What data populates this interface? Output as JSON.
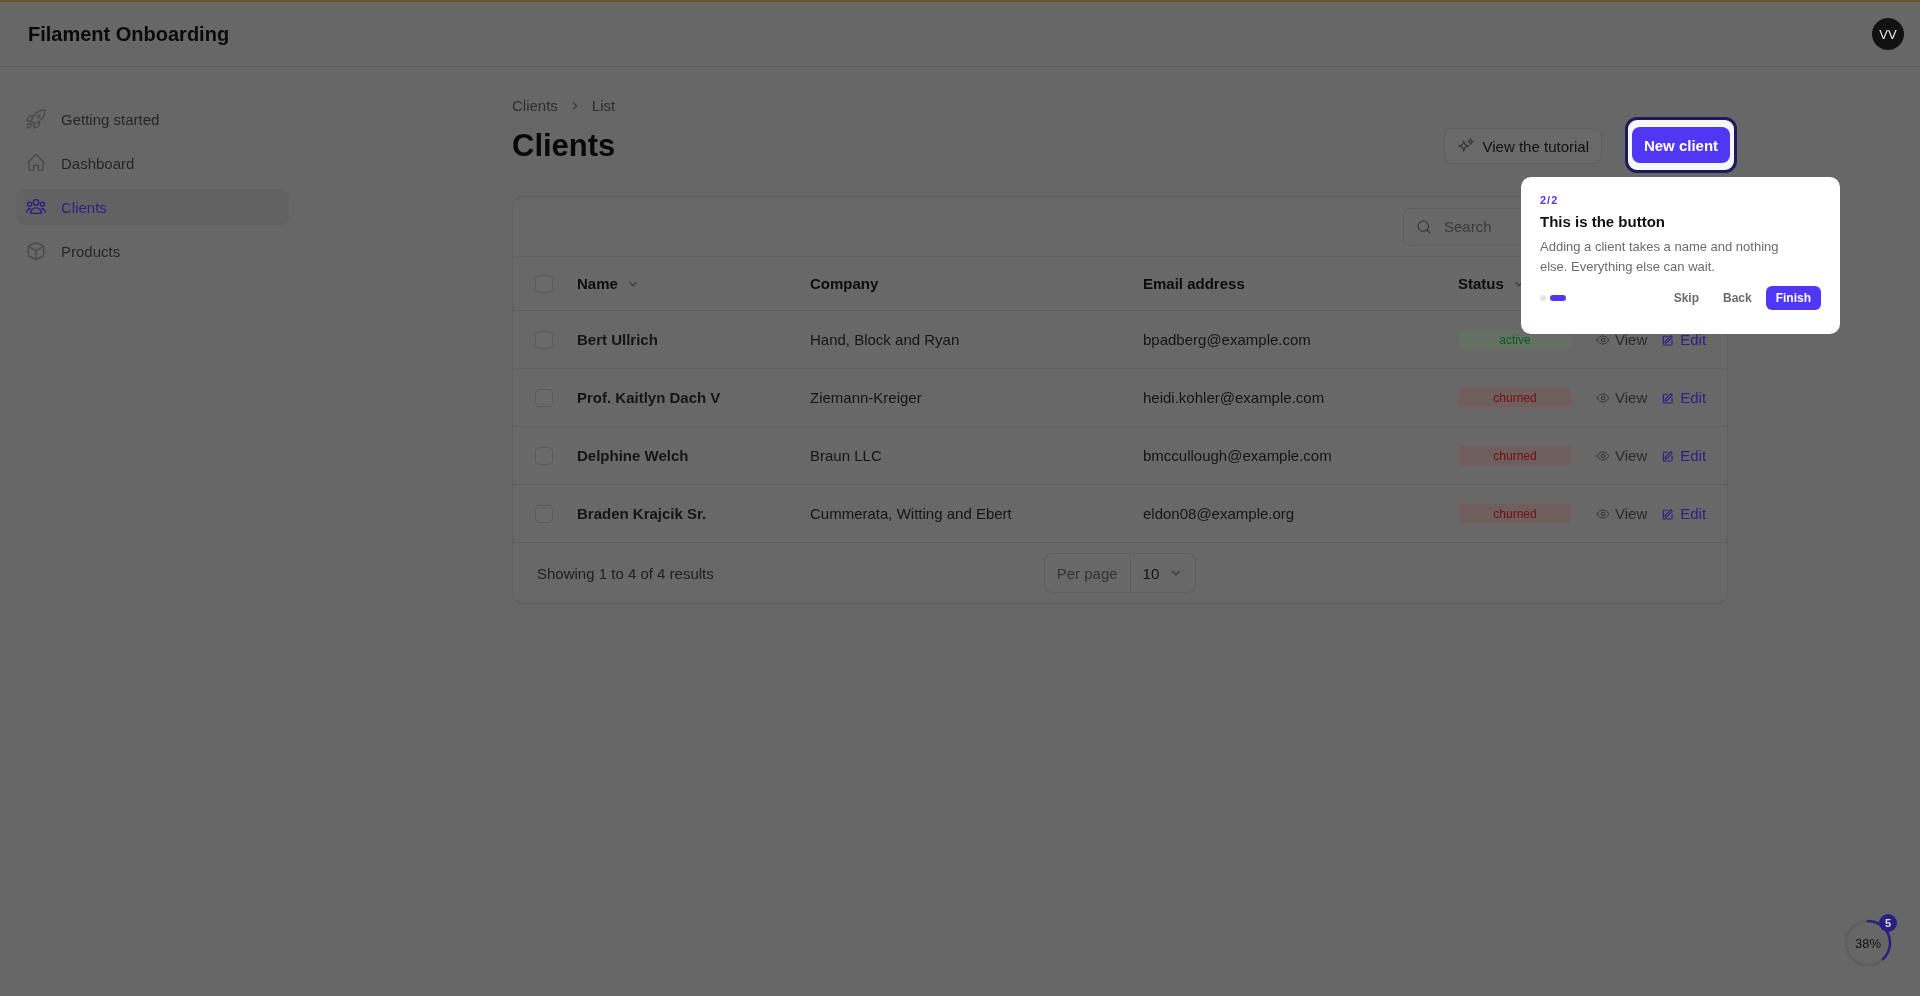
{
  "app": {
    "title": "Filament Onboarding",
    "avatar": "VV"
  },
  "sidebar": {
    "items": [
      {
        "label": "Getting started",
        "selected": false
      },
      {
        "label": "Dashboard",
        "selected": false
      },
      {
        "label": "Clients",
        "selected": true
      },
      {
        "label": "Products",
        "selected": false
      }
    ]
  },
  "breadcrumbs": [
    "Clients",
    "List"
  ],
  "page_title": "Clients",
  "actions": {
    "tutorial": "View the tutorial",
    "new_client": "New client"
  },
  "table": {
    "search": {
      "placeholder": "Search"
    },
    "select_all": {
      "checked": false
    },
    "columns": [
      {
        "label": "Name",
        "sortable": true
      },
      {
        "label": "Company",
        "sortable": false
      },
      {
        "label": "Email address",
        "sortable": false
      },
      {
        "label": "Status",
        "sortable": true
      }
    ],
    "rows": [
      {
        "checked": false,
        "name": "Bert Ullrich",
        "company": "Hand, Block and Ryan",
        "email": "bpadberg@example.com",
        "status": {
          "label": "active",
          "kind": "active"
        },
        "view": "View",
        "edit": "Edit"
      },
      {
        "checked": false,
        "name": "Prof. Kaitlyn Dach V",
        "company": "Ziemann-Kreiger",
        "email": "heidi.kohler@example.com",
        "status": {
          "label": "churned",
          "kind": "churned"
        },
        "view": "View",
        "edit": "Edit"
      },
      {
        "checked": false,
        "name": "Delphine Welch",
        "company": "Braun LLC",
        "email": "bmccullough@example.com",
        "status": {
          "label": "churned",
          "kind": "churned"
        },
        "view": "View",
        "edit": "Edit"
      },
      {
        "checked": false,
        "name": "Braden Krajcik Sr.",
        "company": "Cummerata, Witting and Ebert",
        "email": "eldon08@example.org",
        "status": {
          "label": "churned",
          "kind": "churned"
        },
        "view": "View",
        "edit": "Edit"
      }
    ],
    "footer": {
      "summary": "Showing 1 to 4 of 4 results",
      "per_page_label": "Per page",
      "per_page_value": "10"
    }
  },
  "tour": {
    "step": "2/2",
    "title": "This is the button",
    "body": "Adding a client takes a name and nothing else. Everything else can wait.",
    "steps": [
      {
        "selected": false
      },
      {
        "selected": true
      }
    ],
    "buttons": [
      {
        "label": "Skip",
        "kind": "text"
      },
      {
        "label": "Back",
        "kind": "text"
      },
      {
        "label": "Finish",
        "kind": "primary"
      }
    ]
  },
  "progress": {
    "level": 0.38,
    "reading": "38%",
    "badge": "5"
  }
}
